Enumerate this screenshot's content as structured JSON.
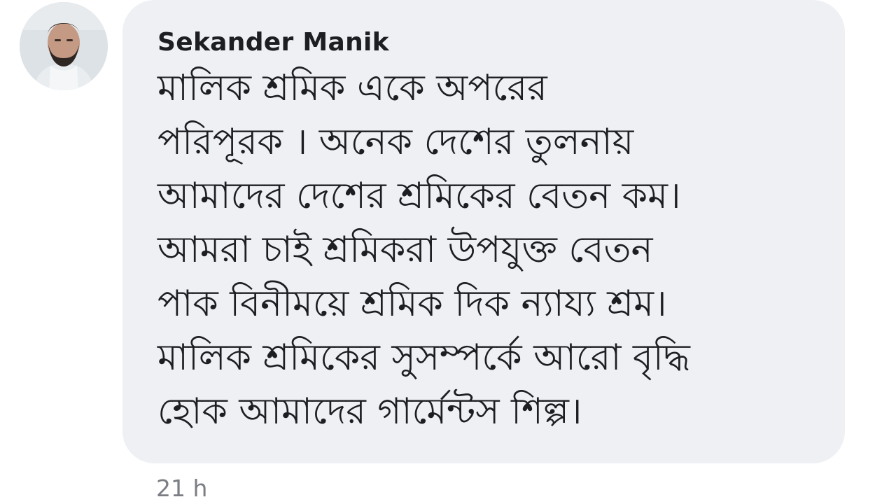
{
  "comment": {
    "author": "Sekander Manik",
    "avatar_icon": "user-avatar",
    "lines": [
      "মালিক শ্রমিক একে অপরের",
      "পরিপূরক । অনেক দেশের তুলনায়",
      "আমাদের দেশের শ্রমিকের বেতন কম।",
      "আমরা চাই শ্রমিকরা উপযুক্ত বেতন",
      "পাক বিনীময়ে শ্রমিক দিক ন্যায্য শ্রম।",
      "মালিক শ্রমিকের সুসম্পর্কে আরো বৃদ্ধি",
      "হোক আমাদের গার্মেন্টস শিল্প।"
    ],
    "timestamp": "21 h"
  },
  "colors": {
    "bubble_bg": "#eef0f4",
    "text": "#1c1e21",
    "meta": "#7a7d83"
  }
}
